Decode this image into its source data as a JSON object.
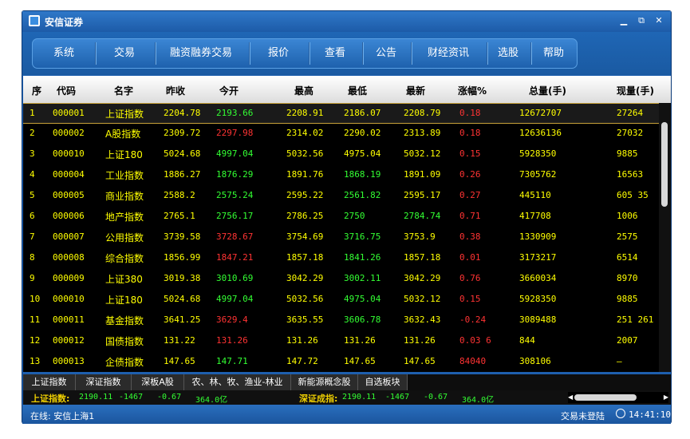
{
  "app": {
    "title": "安信证券"
  },
  "window_buttons": {
    "min": "▁",
    "restore": "⧉",
    "close": "✕"
  },
  "menu": [
    "系统",
    "交易",
    "融资融券交易",
    "报价",
    "查看",
    "公告",
    "财经资讯",
    "选股",
    "帮助"
  ],
  "table": {
    "headers": [
      "序",
      "代码",
      "名字",
      "昨收",
      "今开",
      "最高",
      "最低",
      "最新",
      "涨幅%",
      "总量(手)",
      "现量(手)"
    ],
    "rows": [
      {
        "seq": "1",
        "code": "000001",
        "name": "上证指数",
        "prev": "2204.78",
        "open": "2193.66",
        "high": "2208.91",
        "low": "2186.07",
        "last": "2208.79",
        "chg": "0.18",
        "vol": "12672707",
        "cur": "27264",
        "open_color": "#33ff33",
        "low_color": "#ffff00",
        "selected": true
      },
      {
        "seq": "2",
        "code": "000002",
        "name": "A股指数",
        "prev": "2309.72",
        "open": "2297.98",
        "high": "2314.02",
        "low": "2290.02",
        "last": "2313.89",
        "chg": "0.18",
        "vol": "12636136",
        "cur": "27032",
        "open_color": "#ff3333",
        "low_color": "#ffff00"
      },
      {
        "seq": "3",
        "code": "000010",
        "name": "上证180",
        "prev": "5024.68",
        "open": "4997.04",
        "high": "5032.56",
        "low": "4975.04",
        "last": "5032.12",
        "chg": "0.15",
        "vol": "5928350",
        "cur": "9885",
        "open_color": "#33ff33",
        "low_color": "#ffff00"
      },
      {
        "seq": "4",
        "code": "000004",
        "name": "工业指数",
        "prev": "1886.27",
        "open": "1876.29",
        "high": "1891.76",
        "low": "1868.19",
        "last": "1891.09",
        "chg": "0.26",
        "vol": "7305762",
        "cur": "16563",
        "open_color": "#33ff33",
        "low_color": "#33ff33"
      },
      {
        "seq": "5",
        "code": "000005",
        "name": "商业指数",
        "prev": "2588.2",
        "open": "2575.24",
        "high": "2595.22",
        "low": "2561.82",
        "last": "2595.17",
        "chg": "0.27",
        "vol": "445110",
        "cur": "605 35",
        "open_color": "#33ff33",
        "low_color": "#33ff33"
      },
      {
        "seq": "6",
        "code": "000006",
        "name": "地产指数",
        "prev": "2765.1",
        "open": "2756.17",
        "high": "2786.25",
        "low": "2750",
        "last": "2784.74",
        "chg": "0.71",
        "vol": "417708",
        "cur": "1006",
        "open_color": "#33ff33",
        "low_color": "#33ff33",
        "last_color": "#33ff33"
      },
      {
        "seq": "7",
        "code": "000007",
        "name": "公用指数",
        "prev": "3739.58",
        "open": "3728.67",
        "high": "3754.69",
        "low": "3716.75",
        "last": "3753.9",
        "chg": "0.38",
        "vol": "1330909",
        "cur": "2575",
        "open_color": "#ff3333",
        "low_color": "#33ff33"
      },
      {
        "seq": "8",
        "code": "000008",
        "name": "综合指数",
        "prev": "1856.99",
        "open": "1847.21",
        "high": "1857.18",
        "low": "1841.26",
        "last": "1857.18",
        "chg": "0.01",
        "vol": "3173217",
        "cur": "6514",
        "open_color": "#ff3333",
        "low_color": "#33ff33"
      },
      {
        "seq": "9",
        "code": "000009",
        "name": "上证380",
        "prev": "3019.38",
        "open": "3010.69",
        "high": "3042.29",
        "low": "3002.11",
        "last": "3042.29",
        "chg": "0.76",
        "vol": "3660034",
        "cur": "8970",
        "open_color": "#33ff33",
        "low_color": "#33ff33"
      },
      {
        "seq": "10",
        "code": "000010",
        "name": "上证180",
        "prev": "5024.68",
        "open": "4997.04",
        "high": "5032.56",
        "low": "4975.04",
        "last": "5032.12",
        "chg": "0.15",
        "vol": "5928350",
        "cur": "9885",
        "open_color": "#33ff33",
        "low_color": "#33ff33"
      },
      {
        "seq": "11",
        "code": "000011",
        "name": "基金指数",
        "prev": "3641.25",
        "open": "3629.4",
        "high": "3635.55",
        "low": "3606.78",
        "last": "3632.43",
        "chg": "-0.24",
        "vol": "3089488",
        "cur": "251 261",
        "open_color": "#ff3333",
        "low_color": "#33ff33",
        "chg_color": "#ff3333"
      },
      {
        "seq": "12",
        "code": "000012",
        "name": "国债指数",
        "prev": "131.22",
        "open": "131.26",
        "high": "131.26",
        "low": "131.26",
        "last": "131.26",
        "chg": "0.03   6",
        "vol": "844",
        "cur": "2007",
        "open_color": "#ff3333",
        "low_color": "#ffff00"
      },
      {
        "seq": "13",
        "code": "000013",
        "name": "企债指数",
        "prev": "147.65",
        "open": "147.71",
        "high": "147.72",
        "low": "147.65",
        "last": "147.65",
        "chg": "84040",
        "vol": "308106",
        "cur": "—",
        "open_color": "#33ff33",
        "low_color": "#ffff00"
      }
    ]
  },
  "tabs": [
    "上证指数",
    "深证指数",
    "深板A股",
    "农、林、牧、渔业-林业",
    "新能源概念股",
    "自选板块"
  ],
  "ticker": {
    "sh": {
      "label": "上证指数:",
      "value": "2190.11",
      "chg": "-1467",
      "pct": "-0.67",
      "amount": "364.0亿"
    },
    "sz": {
      "label": "深证成指:",
      "value": "2190.11",
      "chg": "-1467",
      "pct": "-0.67",
      "amount": "364.0亿"
    }
  },
  "status": {
    "online": "在线: 安信上海1",
    "trade": "交易未登陆",
    "time": "14:41:10"
  },
  "colors": {
    "accent": "#1e5fae",
    "up": "#ff3333",
    "down": "#33ff33",
    "flat": "#ffff00",
    "name": "#ffff00"
  }
}
